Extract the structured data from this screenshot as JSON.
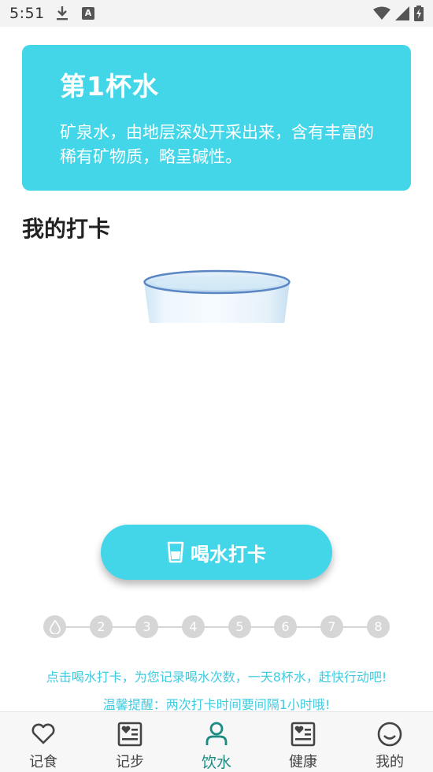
{
  "status_bar": {
    "time": "5:51",
    "a_badge": "A"
  },
  "card": {
    "title": "第1杯水",
    "description": "矿泉水，由地层深处开采出来，含有丰富的稀有矿物质，略呈碱性。"
  },
  "section_title": "我的打卡",
  "drink_button_label": "喝水打卡",
  "progress": {
    "steps": [
      "",
      "2",
      "3",
      "4",
      "5",
      "6",
      "7",
      "8"
    ],
    "completed": 0
  },
  "hints": {
    "line1": "点击喝水打卡，为您记录喝水次数，一天8杯水，赶快行动吧!",
    "line2": "温馨提醒：两次打卡时间要间隔1小时哦!"
  },
  "bottom_nav": {
    "items": [
      {
        "label": "记食",
        "icon": "heart-outline-icon"
      },
      {
        "label": "记步",
        "icon": "heart-list-icon"
      },
      {
        "label": "饮水",
        "icon": "person-icon",
        "active": true
      },
      {
        "label": "健康",
        "icon": "heart-list-icon"
      },
      {
        "label": "我的",
        "icon": "smile-icon"
      }
    ]
  },
  "colors": {
    "accent": "#42d6e8",
    "active_nav": "#1a8a82",
    "inactive_dot": "#d6d6d6",
    "hint_text": "#42cbe0"
  }
}
